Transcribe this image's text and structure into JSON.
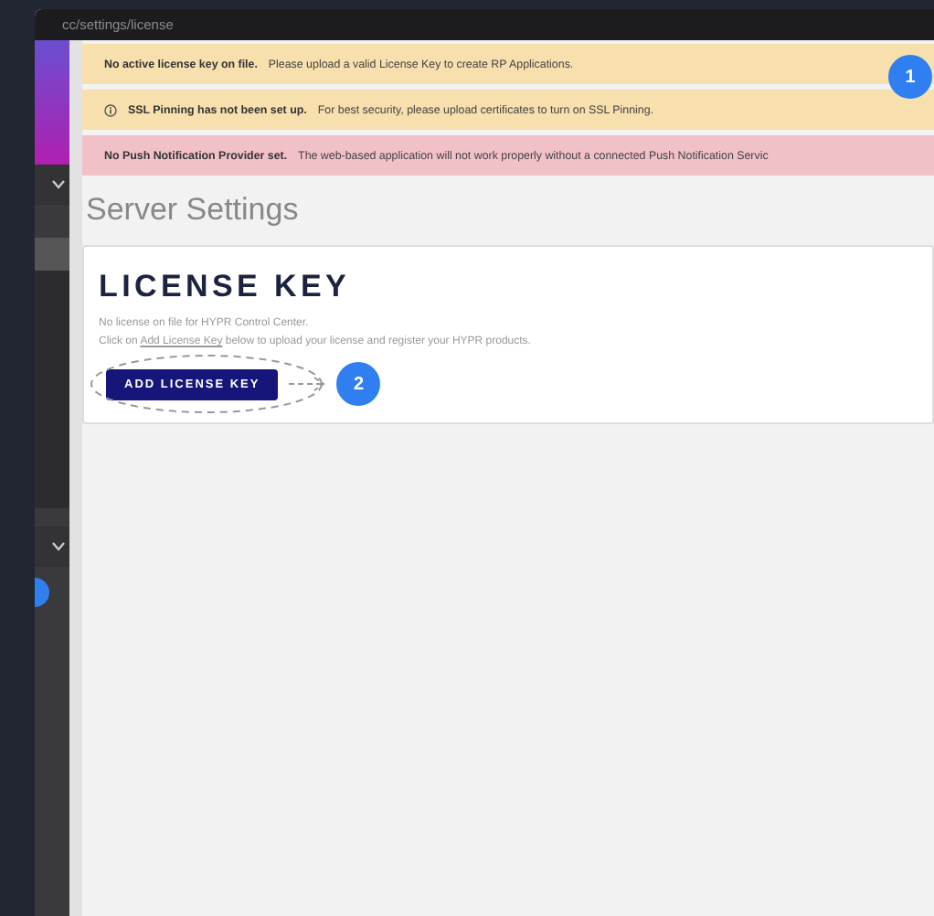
{
  "window": {
    "url": "cc/settings/license"
  },
  "banners": [
    {
      "kind": "warning",
      "icon": false,
      "title": "No active license key on file.",
      "message": "Please upload a valid License Key to create RP Applications."
    },
    {
      "kind": "warning",
      "icon": true,
      "title": "SSL Pinning has not been set up.",
      "message": "For best security, please upload certificates to turn on SSL Pinning."
    },
    {
      "kind": "error",
      "icon": false,
      "title": "No Push Notification Provider set.",
      "message": "The web-based application will not work properly without a connected Push Notification Servic"
    }
  ],
  "page_title": "Server Settings",
  "card": {
    "title": "LICENSE KEY",
    "lines": [
      "No license on file for HYPR Control Center."
    ],
    "instruction": {
      "before": "Click on ",
      "link": "Add License Key",
      "after": " below to upload your license and register your HYPR products."
    },
    "button": "ADD LICENSE KEY"
  },
  "callouts": [
    {
      "label": "1"
    },
    {
      "label": "2"
    }
  ]
}
